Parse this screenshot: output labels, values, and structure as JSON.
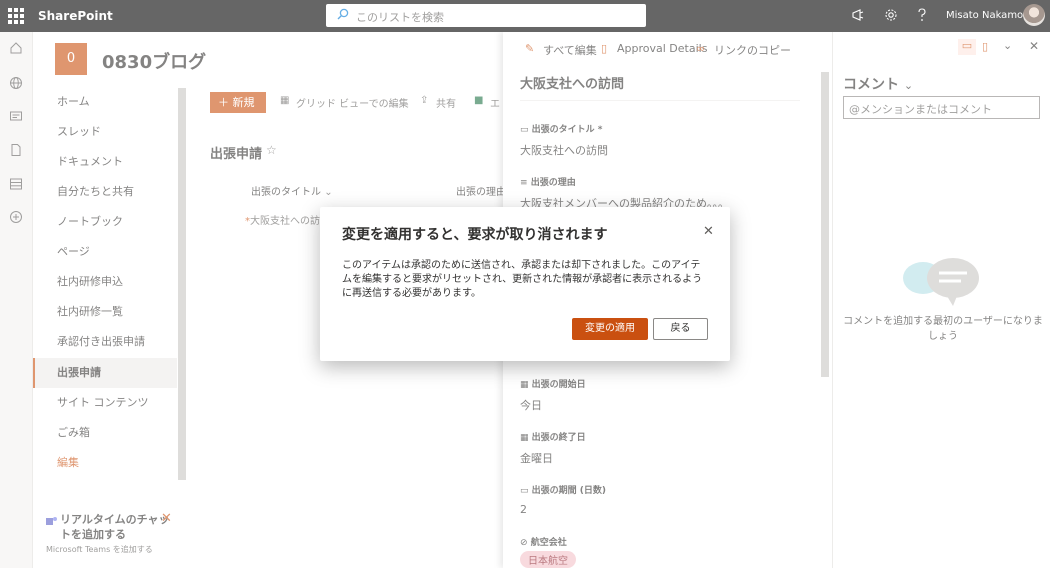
{
  "topbar": {
    "app_name": "SharePoint",
    "search_placeholder": "このリストを検索",
    "user_name": "Misato Nakamori"
  },
  "site": {
    "logo_letter": "0",
    "name": "0830ブログ"
  },
  "nav": {
    "items": [
      "ホーム",
      "スレッド",
      "ドキュメント",
      "自分たちと共有",
      "ノートブック",
      "ページ",
      "社内研修申込",
      "社内研修一覧",
      "承認付き出張申請",
      "出張申請",
      "サイト コンテンツ",
      "ごみ箱",
      "編集"
    ],
    "active_index": 9
  },
  "promo": {
    "title": "リアルタイムのチャットを追加する",
    "subtitle": "Microsoft Teams を追加する"
  },
  "command_bar": {
    "new_label": "新規",
    "grid_edit": "グリッド ビューでの編集",
    "share": "共有",
    "export": "エ"
  },
  "list": {
    "title": "出張申請",
    "col_title": "出張のタイトル",
    "col_reason": "出張の理由",
    "row_title": "大阪支社への訪問"
  },
  "panel": {
    "edit_all": "すべて編集",
    "approval_details": "Approval Details",
    "copy_link": "リンクのコピー",
    "item_title": "大阪支社への訪問",
    "fields": [
      {
        "label": "出張のタイトル *",
        "value": "大阪支社への訪問"
      },
      {
        "label": "出張の理由",
        "value": "大阪支社メンバーへの製品紹介のため。。。"
      },
      {
        "label": "出張の開始日",
        "value": "今日"
      },
      {
        "label": "出張の終了日",
        "value": "金曜日"
      },
      {
        "label": "出張の期間 (日数)",
        "value": "2"
      },
      {
        "label": "航空会社",
        "value": "日本航空"
      }
    ]
  },
  "comments": {
    "title": "コメント",
    "input_placeholder": "@メンションまたはコメント",
    "empty_text": "コメントを追加する最初のユーザーになりましょう"
  },
  "dialog": {
    "title": "変更を適用すると、要求が取り消されます",
    "body": "このアイテムは承認のために送信され、承認または却下されました。このアイテムを編集すると要求がリセットされ、更新された情報が承認者に表示されるように再送信する必要があります。",
    "apply_label": "変更の適用",
    "back_label": "戻る"
  },
  "colors": {
    "accent": "#ca5010",
    "topbar_bg": "#000000",
    "tag_bg": "#f4c2c8"
  }
}
